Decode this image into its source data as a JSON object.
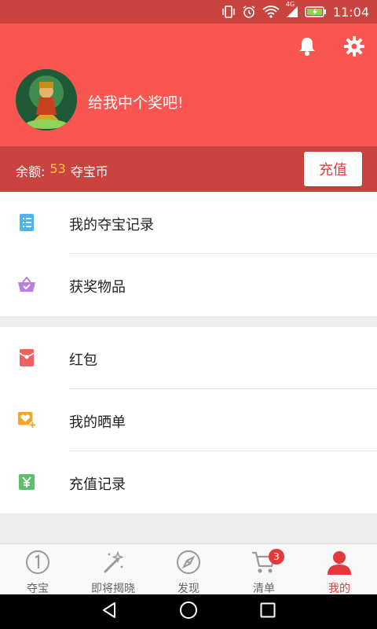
{
  "statusbar": {
    "network": "4G",
    "time": "11:04"
  },
  "header": {
    "username": "给我中个奖吧!",
    "bell_icon": "bell-icon",
    "settings_icon": "gear-icon"
  },
  "balance": {
    "prefix": "余额:",
    "amount": "53",
    "unit": "夺宝币",
    "recharge_label": "充值"
  },
  "menu_group_1": [
    {
      "label": "我的夺宝记录",
      "icon": "list-document-icon",
      "color": "#4fb3f0"
    },
    {
      "label": "获奖物品",
      "icon": "basket-icon",
      "color": "#b780e0"
    }
  ],
  "menu_group_2": [
    {
      "label": "红包",
      "icon": "red-envelope-icon",
      "color": "#f06060"
    },
    {
      "label": "我的晒单",
      "icon": "heart-photo-icon",
      "color": "#f4a623"
    },
    {
      "label": "充值记录",
      "icon": "yen-icon",
      "color": "#5cbf6e"
    }
  ],
  "tabbar": {
    "items": [
      {
        "label": "夺宝",
        "icon": "one-coin-icon"
      },
      {
        "label": "即将揭晓",
        "icon": "magic-wand-icon"
      },
      {
        "label": "发现",
        "icon": "compass-icon"
      },
      {
        "label": "清单",
        "icon": "cart-icon",
        "badge": "3"
      },
      {
        "label": "我的",
        "icon": "user-icon",
        "active": true
      }
    ]
  },
  "colors": {
    "accent": "#fa5651",
    "accent_dark": "#c9443f",
    "amount": "#ffcc33",
    "active_tab": "#e3393c"
  }
}
